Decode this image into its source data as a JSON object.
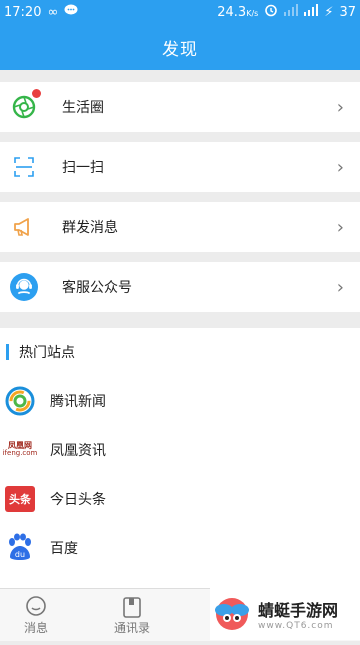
{
  "status": {
    "time": "17:20",
    "speed": "24.3",
    "speed_unit": "K/s",
    "battery": "37"
  },
  "header": {
    "title": "发现"
  },
  "menu": [
    {
      "label": "生活圈",
      "icon": "camera-aperture-icon",
      "has_badge": true
    },
    {
      "label": "扫一扫",
      "icon": "scan-icon"
    },
    {
      "label": "群发消息",
      "icon": "megaphone-icon"
    },
    {
      "label": "客服公众号",
      "icon": "customer-service-icon"
    }
  ],
  "hot_sites": {
    "title": "热门站点",
    "items": [
      {
        "name": "腾讯新闻",
        "logo_text": ""
      },
      {
        "name": "凤凰资讯",
        "logo_text": "凤凰网 ifeng.com"
      },
      {
        "name": "今日头条",
        "logo_text": "头条"
      },
      {
        "name": "百度",
        "logo_text": "du"
      }
    ]
  },
  "tabs": [
    {
      "label": "消息"
    },
    {
      "label": "通讯录"
    }
  ],
  "watermark": {
    "main": "蜻蜓手游网",
    "sub": "www.QT6.com"
  },
  "colors": {
    "primary": "#2c9ff0",
    "badge": "#e84040"
  }
}
